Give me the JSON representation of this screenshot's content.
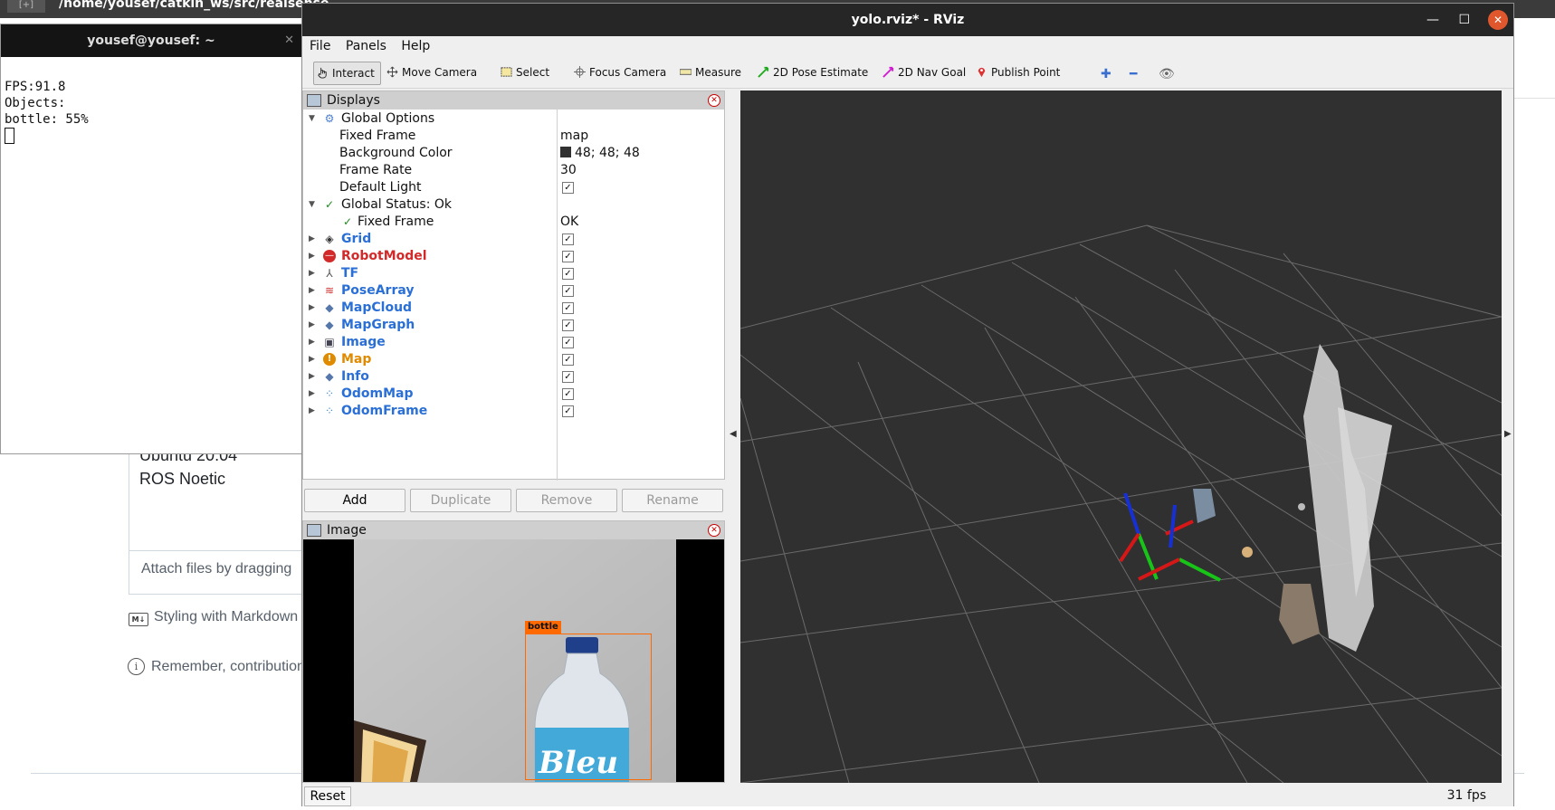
{
  "background": {
    "path_text": "/home/yousef/catkin_ws/src/realsense",
    "ubuntu": "Ubuntu 20.04",
    "ros": "ROS Noetic",
    "attach": "Attach files by dragging",
    "markdown": "Styling with Markdown",
    "remember": "Remember, contribution",
    "md_badge": "M↓"
  },
  "terminal": {
    "title": "yousef@yousef: ~",
    "lines": [
      "FPS:91.8",
      "Objects:",
      "",
      "bottle: 55%"
    ]
  },
  "rviz": {
    "title": "yolo.rviz* - RViz",
    "menu": [
      "File",
      "Panels",
      "Help"
    ],
    "tools": [
      "Interact",
      "Move Camera",
      "Select",
      "Focus Camera",
      "Measure",
      "2D Pose Estimate",
      "2D Nav Goal",
      "Publish Point"
    ],
    "displays_title": "Displays",
    "global_options": {
      "label": "Global Options",
      "fixed_frame_label": "Fixed Frame",
      "fixed_frame_value": "map",
      "bg_color_label": "Background Color",
      "bg_color_value": "48; 48; 48",
      "frame_rate_label": "Frame Rate",
      "frame_rate_value": "30",
      "default_light_label": "Default Light"
    },
    "global_status": {
      "label": "Global Status: Ok",
      "fixed_frame_label": "Fixed Frame",
      "fixed_frame_value": "OK"
    },
    "displays": [
      {
        "name": "Grid",
        "color": "blue"
      },
      {
        "name": "RobotModel",
        "color": "red"
      },
      {
        "name": "TF",
        "color": "blue"
      },
      {
        "name": "PoseArray",
        "color": "blue"
      },
      {
        "name": "MapCloud",
        "color": "blue"
      },
      {
        "name": "MapGraph",
        "color": "blue"
      },
      {
        "name": "Image",
        "color": "blue"
      },
      {
        "name": "Map",
        "color": "orange"
      },
      {
        "name": "Info",
        "color": "blue"
      },
      {
        "name": "OdomMap",
        "color": "blue"
      },
      {
        "name": "OdomFrame",
        "color": "blue"
      }
    ],
    "buttons": [
      "Add",
      "Duplicate",
      "Remove",
      "Rename"
    ],
    "image_panel_title": "Image",
    "detection_label": "bottle",
    "bottle_text": "Bleu",
    "reset": "Reset",
    "fps": "31 fps",
    "bg_color": "#303030"
  }
}
